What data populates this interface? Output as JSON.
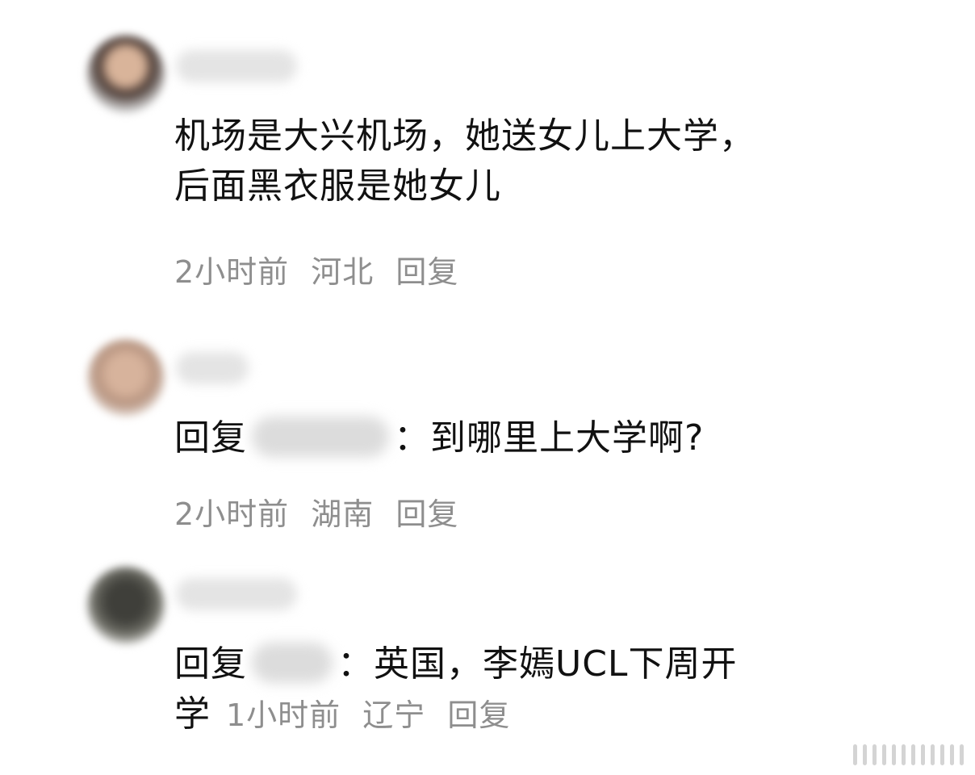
{
  "comments": [
    {
      "username": "",
      "text_line1": "机场是大兴机场，她送女儿上大学，",
      "text_line2": "后面黑衣服是她女儿",
      "time": "2小时前",
      "location": "河北",
      "reply_label": "回复"
    },
    {
      "username": "",
      "reply_prefix": "回复",
      "text": "：到哪里上大学啊?",
      "time": "2小时前",
      "location": "湖南",
      "reply_label": "回复"
    },
    {
      "username": "",
      "reply_prefix": "回复",
      "text_line1": "：英国，李嫣UCL下周开",
      "text_line2_start": "学",
      "time": "1小时前",
      "location": "辽宁",
      "reply_label": "回复"
    }
  ],
  "colors": {
    "text": "#111111",
    "meta": "#8e8e8e",
    "background": "#ffffff"
  }
}
